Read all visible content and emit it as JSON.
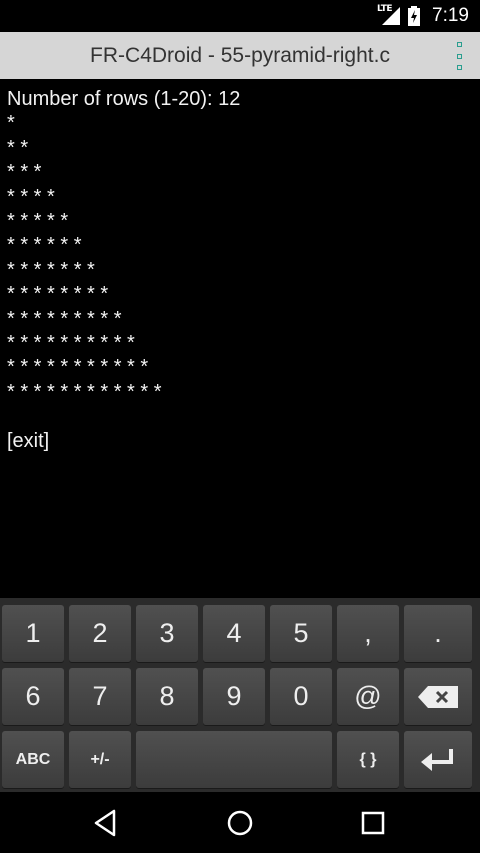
{
  "status_bar": {
    "network": "LTE",
    "time": "7:19",
    "icons": [
      "signal-icon",
      "battery-charging-icon"
    ]
  },
  "app_bar": {
    "title": "FR-C4Droid - 55-pyramid-right.c",
    "menu_icon": "overflow-menu-icon"
  },
  "terminal": {
    "lines": [
      "Number of rows (1-20): 12",
      "*",
      "* *",
      "* * *",
      "* * * *",
      "* * * * *",
      "* * * * * *",
      "* * * * * * *",
      "* * * * * * * *",
      "* * * * * * * * *",
      "* * * * * * * * * *",
      "* * * * * * * * * * *",
      "* * * * * * * * * * * *",
      "",
      "[exit]"
    ]
  },
  "keyboard": {
    "row1": [
      "1",
      "2",
      "3",
      "4",
      "5",
      ",",
      "."
    ],
    "row2": [
      "6",
      "7",
      "8",
      "9",
      "0",
      "@"
    ],
    "row3": {
      "abc": "ABC",
      "sign": "+/-",
      "braces": "{ }"
    },
    "icons": [
      "backspace-icon",
      "enter-icon"
    ]
  },
  "nav_bar": {
    "icons": [
      "back-icon",
      "home-icon",
      "recents-icon"
    ]
  }
}
